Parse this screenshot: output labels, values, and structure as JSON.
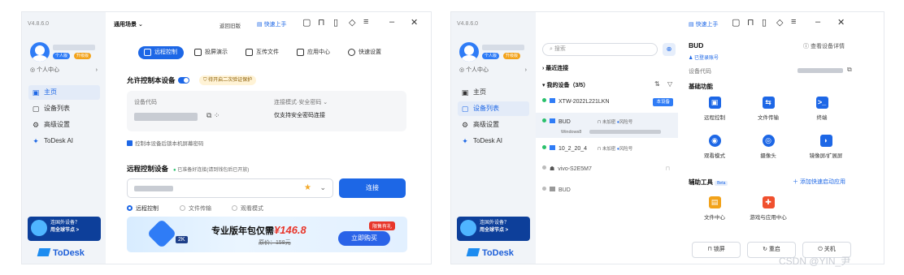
{
  "version": "V4.8.6.0",
  "left": {
    "badge_personal": "个人版",
    "badge_upgrade": "升级版",
    "personal_center": "个人中心",
    "nav_home": "主页",
    "nav_devices": "设备列表",
    "nav_settings": "高级设置",
    "nav_ai": "ToDesk AI",
    "promo_line1": "连国外设备？",
    "promo_line2": "用全球节点 >",
    "brand": "ToDesk",
    "scene": "通用场景",
    "old_version": "返回旧版",
    "quick_start": "快速上手",
    "tabs": [
      "远程控制",
      "投屏演示",
      "互传文件",
      "应用中心",
      "快速设置"
    ],
    "allow_control": "允许控制本设备",
    "second_verify": "待开启二次验证保护",
    "device_code_label": "设备代码",
    "connect_mode": "连接模式·安全密码",
    "only_secure": "仅支持安全密码连接",
    "lock_after": "控制本设备后锁本机屏幕密码",
    "remote_title": "远程控制设备",
    "remote_hint": "已准备好连接(请到钱包后已开放)",
    "connect": "连接",
    "opt_remote": "远程控制",
    "opt_file": "文件传输",
    "opt_view": "观看模式",
    "ad_main": "专业版年包仅需",
    "ad_price": "¥146.8",
    "ad_orig": "原价：158元",
    "ad_tag": "限售有礼",
    "ad_btn": "立即购买",
    "ad_badge": "2K"
  },
  "right": {
    "search": "搜索",
    "recent": "最近连接",
    "my_devices": "我的设备（3/5）",
    "devices": [
      {
        "name": "XTW-2022L221LKN",
        "status": "本设备",
        "online": true
      },
      {
        "name": "BUD",
        "sub": "Windows8",
        "online": true,
        "a1": "未加密",
        "a2": "风险号"
      },
      {
        "name": "10_2_20_4",
        "online": true,
        "a1": "未加密",
        "a2": "风险号"
      },
      {
        "name": "vivo-S2E5M7",
        "online": false
      },
      {
        "name": "BUD",
        "online": false
      }
    ],
    "detail_title": "BUD",
    "detail_link": "查看设备详情",
    "registered": "已登录账号",
    "code_label": "设备代码",
    "basic": "基础功能",
    "func": [
      "远程控制",
      "文件传输",
      "终端",
      "观看模式",
      "摄像头",
      "镜像屏/扩展屏"
    ],
    "aux": "辅助工具",
    "beta": "Beta",
    "add_app": "添加快速启动应用",
    "aux_items": [
      "文件中心",
      "游戏与应用中心"
    ],
    "lock": "锁屏",
    "restart": "重启",
    "shutdown": "关机"
  },
  "watermark": "CSDN @YIN_尹",
  "colors": {
    "accent": "#1d67e6",
    "sidebar": "#f1f4f8"
  }
}
